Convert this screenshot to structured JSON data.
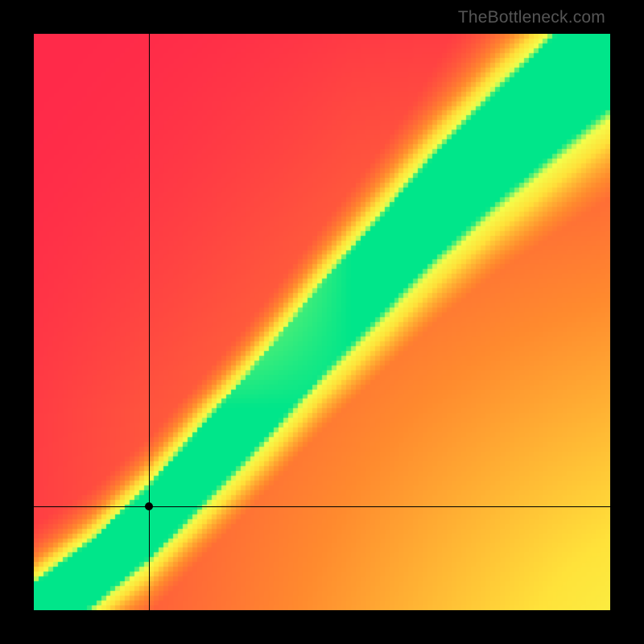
{
  "watermark": "TheBottleneck.com",
  "chart_data": {
    "type": "heatmap",
    "title": "",
    "xlabel": "",
    "ylabel": "",
    "xlim": [
      0,
      1
    ],
    "ylim": [
      0,
      1
    ],
    "grid": false,
    "legend": false,
    "marker": {
      "x": 0.2,
      "y": 0.18
    },
    "crosshair": {
      "x": 0.2,
      "y": 0.18
    },
    "optimal_band": {
      "description": "Green ridge of ideal pairing; value = 1 on ridge, falls off to 0 away from it",
      "ridge_points": [
        {
          "x": 0.0,
          "y": 0.0
        },
        {
          "x": 0.1,
          "y": 0.07
        },
        {
          "x": 0.2,
          "y": 0.16
        },
        {
          "x": 0.3,
          "y": 0.27
        },
        {
          "x": 0.4,
          "y": 0.38
        },
        {
          "x": 0.5,
          "y": 0.5
        },
        {
          "x": 0.6,
          "y": 0.61
        },
        {
          "x": 0.7,
          "y": 0.72
        },
        {
          "x": 0.8,
          "y": 0.82
        },
        {
          "x": 0.9,
          "y": 0.91
        },
        {
          "x": 1.0,
          "y": 1.0
        }
      ],
      "band_half_width": 0.045
    },
    "color_scale": [
      {
        "value": 0.0,
        "color": "#ff2a49"
      },
      {
        "value": 0.35,
        "color": "#ff8a2e"
      },
      {
        "value": 0.6,
        "color": "#ffe23a"
      },
      {
        "value": 0.82,
        "color": "#f4ff4c"
      },
      {
        "value": 1.0,
        "color": "#00e68a"
      }
    ],
    "resolution": 120
  }
}
